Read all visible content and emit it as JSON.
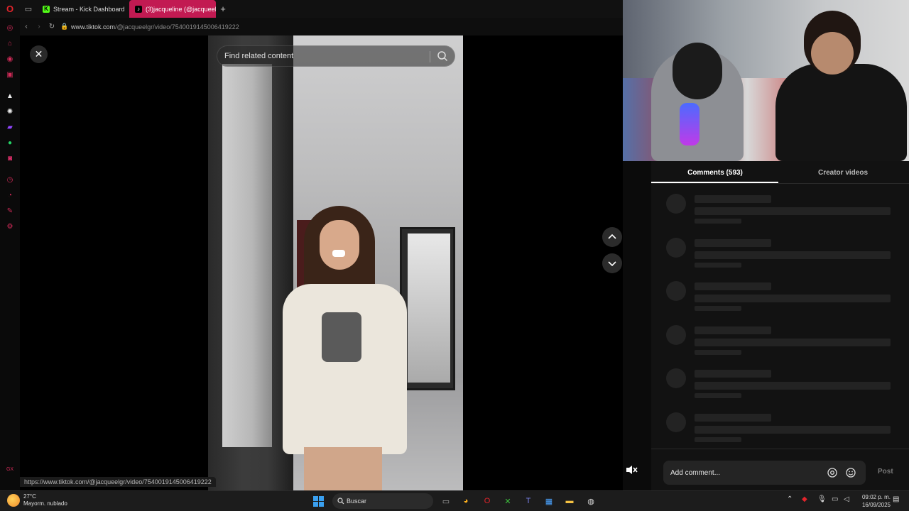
{
  "browser": {
    "tabs": [
      {
        "label": "Stream - Kick Dashboard",
        "favicon": "kick-icon"
      },
      {
        "label": "(3)jacqueline (@jacqueel",
        "favicon": "tiktok-icon",
        "active": true
      }
    ],
    "new_tab": "+",
    "url_host": "www.tiktok.com",
    "url_path": "/@jacqueelgr/video/7540019145006419222",
    "status_url": "https://www.tiktok.com/@jacqueelgr/video/7540019145006419222"
  },
  "video": {
    "search_placeholder": "Find related content"
  },
  "comments": {
    "tab_comments": "Comments (593)",
    "tab_creator": "Creator videos",
    "input_placeholder": "Add comment...",
    "post_label": "Post",
    "loading_rows": 6
  },
  "taskbar": {
    "temperature": "27°C",
    "weather": "Mayorm. nublado",
    "search": "Buscar",
    "time": "09:02 p. m.",
    "date": "16/09/2025"
  },
  "colors": {
    "opera_red": "#e3242b",
    "active_tab": "#c21a52",
    "kick_green": "#53fc18"
  }
}
